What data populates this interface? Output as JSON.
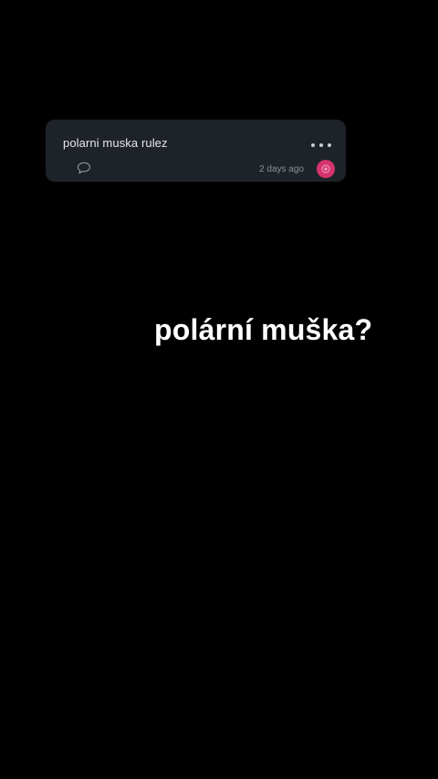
{
  "comment": {
    "text": "polarni muska rulez",
    "timestamp": "2 days ago",
    "reply_icon": "speech-bubble-icon",
    "more_icon": "ellipsis-icon",
    "avatar_color": "#d6336c"
  },
  "caption": {
    "text": "polární muška?"
  },
  "colors": {
    "background": "#000000",
    "card": "#1e2329",
    "caption": "#ffffff"
  }
}
